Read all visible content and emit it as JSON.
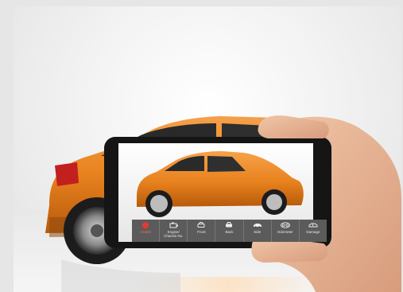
{
  "phone_app": {
    "buttons": [
      {
        "label": "Assets",
        "icon": "stop-icon",
        "active": true
      },
      {
        "label": "Engine/\nChassis No.",
        "icon": "engine-icon",
        "active": false
      },
      {
        "label": "Front",
        "icon": "car-front-icon",
        "active": false
      },
      {
        "label": "Back",
        "icon": "car-back-icon",
        "active": false
      },
      {
        "label": "Side",
        "icon": "car-side-icon",
        "active": false
      },
      {
        "label": "Odometer",
        "icon": "odometer-icon",
        "active": false
      },
      {
        "label": "Damage",
        "icon": "damaged-car-icon",
        "active": false
      }
    ]
  },
  "colors": {
    "car_orange": "#e8821e",
    "phone_body": "#1a1a1a",
    "skin": "#e9b89a",
    "active_red": "#e23b2e"
  }
}
